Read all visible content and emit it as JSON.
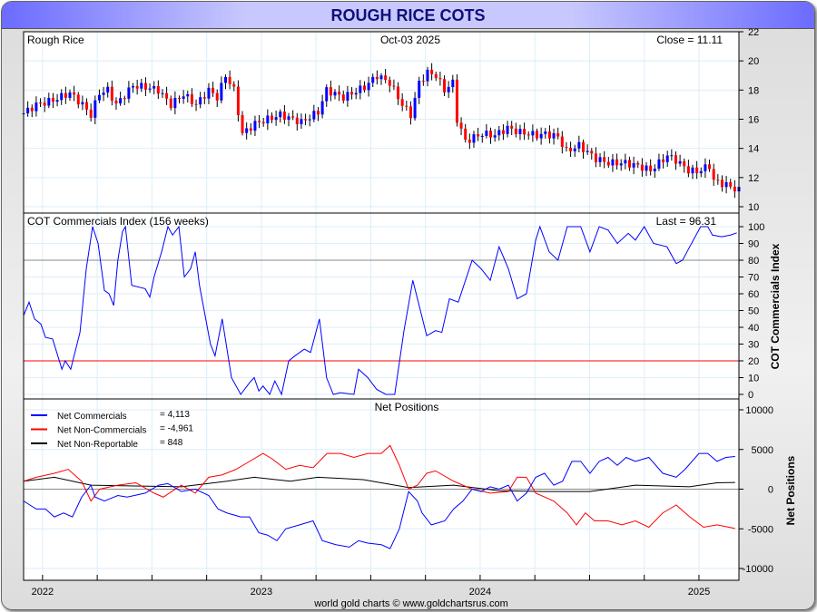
{
  "title": "ROUGH RICE COTS",
  "footer": "world gold charts © www.goldchartsrus.com",
  "colors": {
    "up": "#0000ff",
    "down": "#ff0000",
    "commercials": "#0000ff",
    "noncommercials": "#ff0000",
    "nonreportable": "#000000",
    "grid": "#dceefa",
    "line80": "#888888",
    "line20": "#ff0000"
  },
  "chart_data": [
    {
      "type": "candlestick",
      "name": "price",
      "label": "Rough Rice",
      "date": "Oct-03  2025",
      "close_label": "Close = 11.11",
      "ylim": [
        10,
        22
      ],
      "yticks": [
        10,
        12,
        14,
        16,
        18,
        20,
        22
      ],
      "points": [
        [
          0,
          16.4
        ],
        [
          3,
          17
        ],
        [
          7,
          17.3
        ],
        [
          11,
          17.8
        ],
        [
          14,
          17
        ],
        [
          16,
          16.3
        ],
        [
          18,
          17.8
        ],
        [
          20,
          18
        ],
        [
          22,
          17
        ],
        [
          26,
          18.3
        ],
        [
          29,
          18.2
        ],
        [
          32,
          18
        ],
        [
          35,
          17
        ],
        [
          38,
          17.7
        ],
        [
          41,
          17
        ],
        [
          44,
          18
        ],
        [
          46,
          17.5
        ],
        [
          48,
          19
        ],
        [
          50,
          18
        ],
        [
          52,
          15
        ],
        [
          55,
          15.7
        ],
        [
          58,
          16
        ],
        [
          61,
          16.3
        ],
        [
          66,
          15.8
        ],
        [
          70,
          16.5
        ],
        [
          72,
          18
        ],
        [
          76,
          17.5
        ],
        [
          81,
          18.2
        ],
        [
          84,
          19
        ],
        [
          87,
          18.5
        ],
        [
          90,
          17
        ],
        [
          92,
          16.3
        ],
        [
          94,
          18.5
        ],
        [
          96,
          19.2
        ],
        [
          98,
          19
        ],
        [
          100,
          18
        ],
        [
          102,
          18.5
        ],
        [
          103,
          16
        ],
        [
          105,
          14.5
        ],
        [
          109,
          15
        ],
        [
          112,
          14.9
        ],
        [
          115,
          15.4
        ],
        [
          118,
          15.1
        ],
        [
          122,
          14.9
        ],
        [
          124,
          15
        ],
        [
          127,
          14.8
        ],
        [
          129,
          13.8
        ],
        [
          132,
          14.2
        ],
        [
          136,
          13.3
        ],
        [
          139,
          13
        ],
        [
          143,
          13
        ],
        [
          146,
          12.8
        ],
        [
          149,
          12.5
        ],
        [
          153,
          13.5
        ],
        [
          155,
          13.2
        ],
        [
          158,
          12.5
        ],
        [
          160,
          12.4
        ],
        [
          163,
          12.8
        ],
        [
          164,
          11.8
        ],
        [
          167,
          11.5
        ],
        [
          170,
          11.11
        ]
      ]
    },
    {
      "type": "line",
      "name": "cot-index",
      "label": "COT Commercials Index (156 weeks)",
      "last_label": "Last = 96.31",
      "ylabel": "COT Commercials Index",
      "ylim": [
        0,
        100
      ],
      "yticks": [
        0,
        10,
        20,
        30,
        40,
        50,
        60,
        70,
        80,
        90,
        100
      ],
      "ref_lines": [
        80,
        20
      ],
      "points": [
        [
          0,
          47
        ],
        [
          1.3,
          55
        ],
        [
          2.6,
          45
        ],
        [
          4.1,
          42
        ],
        [
          5.2,
          34
        ],
        [
          6.9,
          33
        ],
        [
          9.1,
          15
        ],
        [
          9.9,
          20
        ],
        [
          11.2,
          15
        ],
        [
          13.4,
          37
        ],
        [
          14.9,
          75
        ],
        [
          16.4,
          100
        ],
        [
          17.7,
          90
        ],
        [
          19.2,
          62
        ],
        [
          20.3,
          60
        ],
        [
          21.4,
          53
        ],
        [
          22.4,
          80
        ],
        [
          23.5,
          97
        ],
        [
          24.2,
          100
        ],
        [
          25.7,
          65
        ],
        [
          28.9,
          63
        ],
        [
          30,
          58
        ],
        [
          31,
          70
        ],
        [
          32.8,
          85
        ],
        [
          34.3,
          100
        ],
        [
          35.4,
          95
        ],
        [
          36.9,
          100
        ],
        [
          38.2,
          70
        ],
        [
          39.7,
          75
        ],
        [
          40.8,
          85
        ],
        [
          41.8,
          65
        ],
        [
          44.4,
          30
        ],
        [
          45.5,
          23
        ],
        [
          47.2,
          45
        ],
        [
          49.4,
          10
        ],
        [
          51.6,
          0
        ],
        [
          53.7,
          7
        ],
        [
          54.8,
          10
        ],
        [
          55.9,
          2
        ],
        [
          56.9,
          5
        ],
        [
          58.5,
          0
        ],
        [
          59.7,
          8
        ],
        [
          61.3,
          0
        ],
        [
          63,
          20
        ],
        [
          64.5,
          23
        ],
        [
          66.7,
          27
        ],
        [
          68.2,
          25
        ],
        [
          70.3,
          45
        ],
        [
          72,
          10
        ],
        [
          73.6,
          0
        ],
        [
          75.3,
          1
        ],
        [
          78.5,
          0
        ],
        [
          79.6,
          15
        ],
        [
          81.8,
          10
        ],
        [
          83.9,
          3
        ],
        [
          86.1,
          0
        ],
        [
          88.2,
          0
        ],
        [
          90.4,
          38
        ],
        [
          92.5,
          68
        ],
        [
          94.3,
          50
        ],
        [
          95.8,
          35
        ],
        [
          97.9,
          38
        ],
        [
          99.4,
          37
        ],
        [
          101.2,
          57
        ],
        [
          103.3,
          55
        ],
        [
          106.6,
          80
        ],
        [
          108.7,
          75
        ],
        [
          110.9,
          68
        ],
        [
          113,
          88
        ],
        [
          115.2,
          75
        ],
        [
          117.3,
          57
        ],
        [
          119.5,
          60
        ],
        [
          121.7,
          92
        ],
        [
          122.7,
          100
        ],
        [
          124.9,
          85
        ],
        [
          127,
          80
        ],
        [
          129.2,
          100
        ],
        [
          132.4,
          100
        ],
        [
          134.6,
          85
        ],
        [
          136.8,
          100
        ],
        [
          138.9,
          98
        ],
        [
          141.1,
          90
        ],
        [
          143.7,
          96
        ],
        [
          145.4,
          92
        ],
        [
          147.5,
          100
        ],
        [
          149.7,
          90
        ],
        [
          152.9,
          88
        ],
        [
          155.1,
          78
        ],
        [
          156.6,
          80
        ],
        [
          158.3,
          88
        ],
        [
          160.9,
          100
        ],
        [
          162.6,
          100
        ],
        [
          163.7,
          95
        ],
        [
          165.9,
          94
        ],
        [
          168,
          95
        ],
        [
          169.5,
          96.31
        ]
      ]
    },
    {
      "type": "line",
      "name": "net-positions",
      "title": "Net Positions",
      "ylabel": "Net Positions",
      "ylim": [
        -10000,
        10000
      ],
      "yticks": [
        -10000,
        -5000,
        0,
        5000,
        10000
      ],
      "series": [
        {
          "name": "Net Commercials",
          "value_label": "= 4,113",
          "color": "#0000ff",
          "points": [
            [
              0,
              -1500
            ],
            [
              3,
              -2500
            ],
            [
              5.2,
              -2500
            ],
            [
              7.3,
              -3500
            ],
            [
              9.5,
              -3000
            ],
            [
              11.6,
              -3500
            ],
            [
              13.8,
              -1000
            ],
            [
              16,
              500
            ],
            [
              17,
              -1000
            ],
            [
              19.2,
              -1500
            ],
            [
              22.4,
              -800
            ],
            [
              24.6,
              -1000
            ],
            [
              28.9,
              -500
            ],
            [
              32.1,
              500
            ],
            [
              34.3,
              700
            ],
            [
              37.5,
              -300
            ],
            [
              40.8,
              0
            ],
            [
              44,
              -800
            ],
            [
              46.2,
              -2500
            ],
            [
              48.3,
              -3000
            ],
            [
              51.6,
              -3500
            ],
            [
              53.7,
              -3500
            ],
            [
              55.9,
              -5500
            ],
            [
              58,
              -5800
            ],
            [
              60.2,
              -6500
            ],
            [
              62.3,
              -5000
            ],
            [
              65.6,
              -4500
            ],
            [
              68.8,
              -4000
            ],
            [
              71,
              -6500
            ],
            [
              74.2,
              -7000
            ],
            [
              77.4,
              -7300
            ],
            [
              79.6,
              -6500
            ],
            [
              81.8,
              -6800
            ],
            [
              85,
              -7000
            ],
            [
              87.1,
              -7500
            ],
            [
              89.3,
              -5000
            ],
            [
              91.5,
              -300
            ],
            [
              93.6,
              -1500
            ],
            [
              94.7,
              -3000
            ],
            [
              96.9,
              -4500
            ],
            [
              100.1,
              -4000
            ],
            [
              102.2,
              -2500
            ],
            [
              104.4,
              -1500
            ],
            [
              106.6,
              0
            ],
            [
              108.7,
              -300
            ],
            [
              110.9,
              300
            ],
            [
              113,
              0
            ],
            [
              115.2,
              500
            ],
            [
              117.3,
              -1500
            ],
            [
              119.5,
              -500
            ],
            [
              121.7,
              1500
            ],
            [
              123.8,
              2000
            ],
            [
              126,
              500
            ],
            [
              128.1,
              1000
            ],
            [
              130.3,
              3500
            ],
            [
              132.4,
              3500
            ],
            [
              134.6,
              2000
            ],
            [
              136.8,
              3500
            ],
            [
              138.9,
              4000
            ],
            [
              141.1,
              3000
            ],
            [
              143.2,
              4000
            ],
            [
              145.4,
              3500
            ],
            [
              148.6,
              4000
            ],
            [
              151.9,
              2000
            ],
            [
              155.1,
              1500
            ],
            [
              157.2,
              2500
            ],
            [
              160.5,
              4500
            ],
            [
              162.6,
              4500
            ],
            [
              164.8,
              3500
            ],
            [
              166.9,
              4000
            ],
            [
              169.1,
              4113
            ]
          ]
        },
        {
          "name": "Net Non-Commercials",
          "value_label": "= -4,961",
          "color": "#ff0000",
          "points": [
            [
              0,
              1000
            ],
            [
              3,
              1500
            ],
            [
              7.3,
              2000
            ],
            [
              10.6,
              2500
            ],
            [
              13.8,
              1000
            ],
            [
              16,
              -1500
            ],
            [
              18.1,
              0
            ],
            [
              22.4,
              500
            ],
            [
              26.7,
              800
            ],
            [
              31,
              -500
            ],
            [
              33.2,
              -1000
            ],
            [
              37.5,
              500
            ],
            [
              40.8,
              -500
            ],
            [
              44,
              1500
            ],
            [
              47.2,
              1800
            ],
            [
              50.5,
              2500
            ],
            [
              53.7,
              3500
            ],
            [
              56.9,
              4500
            ],
            [
              59.1,
              3800
            ],
            [
              62.3,
              2500
            ],
            [
              65.6,
              3000
            ],
            [
              68.8,
              2700
            ],
            [
              72.1,
              4500
            ],
            [
              75.3,
              4500
            ],
            [
              78.5,
              4000
            ],
            [
              81.8,
              4500
            ],
            [
              85,
              4500
            ],
            [
              87.1,
              5500
            ],
            [
              89.3,
              3000
            ],
            [
              91.5,
              0
            ],
            [
              93.6,
              500
            ],
            [
              95.8,
              2000
            ],
            [
              97.9,
              2300
            ],
            [
              102.2,
              1000
            ],
            [
              106.6,
              0
            ],
            [
              110.9,
              -500
            ],
            [
              115.2,
              -300
            ],
            [
              117.3,
              1500
            ],
            [
              119.5,
              1500
            ],
            [
              121.7,
              -500
            ],
            [
              126,
              -1500
            ],
            [
              129.2,
              -3000
            ],
            [
              131.4,
              -4500
            ],
            [
              133.5,
              -3000
            ],
            [
              135.7,
              -4000
            ],
            [
              138.9,
              -4000
            ],
            [
              142.2,
              -4500
            ],
            [
              145.4,
              -4000
            ],
            [
              148.6,
              -4800
            ],
            [
              151.9,
              -3000
            ],
            [
              155.1,
              -2000
            ],
            [
              158.3,
              -3500
            ],
            [
              161.6,
              -4800
            ],
            [
              164.8,
              -4500
            ],
            [
              169.1,
              -4961
            ]
          ]
        },
        {
          "name": "Net Non-Reportable",
          "value_label": "= 848",
          "color": "#000000",
          "points": [
            [
              0,
              1000
            ],
            [
              7.3,
              1500
            ],
            [
              16,
              500
            ],
            [
              37.5,
              300
            ],
            [
              48.3,
              1000
            ],
            [
              54.8,
              1500
            ],
            [
              63.4,
              1000
            ],
            [
              69.9,
              1500
            ],
            [
              80.7,
              1200
            ],
            [
              91.5,
              200
            ],
            [
              102.2,
              500
            ],
            [
              113,
              -200
            ],
            [
              123.8,
              -300
            ],
            [
              134.6,
              -300
            ],
            [
              145.4,
              500
            ],
            [
              158.3,
              300
            ],
            [
              164.8,
              800
            ],
            [
              169.1,
              848
            ]
          ]
        }
      ]
    }
  ],
  "xaxis": {
    "labels": [
      {
        "text": "2022",
        "w": 4.5
      },
      {
        "text": "2023",
        "w": 56.5
      },
      {
        "text": "2024",
        "w": 108.5
      },
      {
        "text": "2025",
        "w": 160.5
      }
    ],
    "range": [
      0,
      170
    ]
  }
}
